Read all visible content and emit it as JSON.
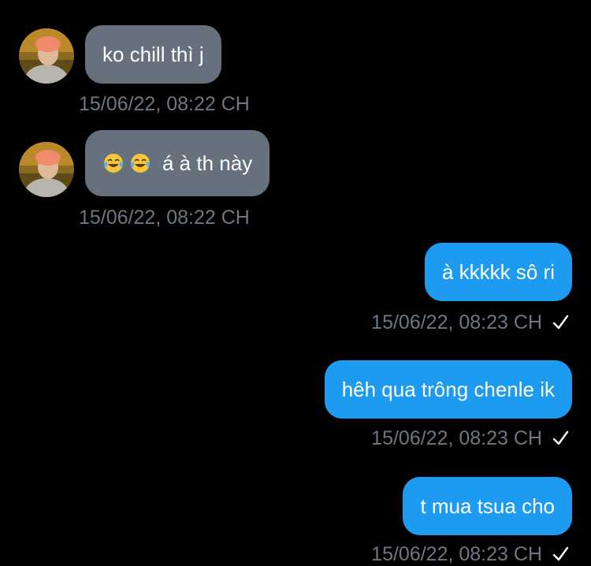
{
  "messages": [
    {
      "direction": "incoming",
      "text": "ko chill thì j",
      "timestamp": "15/06/22, 08:22 CH"
    },
    {
      "direction": "incoming",
      "emoji": [
        "face-with-tears-of-joy-icon",
        "face-with-tears-of-joy-icon"
      ],
      "text": "á à th này",
      "timestamp": "15/06/22, 08:22 CH"
    },
    {
      "direction": "outgoing",
      "text": "à kkkkk sô ri",
      "timestamp": "15/06/22, 08:23 CH",
      "status": "sent-check-icon"
    },
    {
      "direction": "outgoing",
      "text": "hêh qua trông chenle ik",
      "timestamp": "15/06/22, 08:23 CH",
      "status": "sent-check-icon"
    },
    {
      "direction": "outgoing",
      "text": "t mua tsua cho",
      "timestamp": "15/06/22, 08:23 CH",
      "status": "sent-check-icon"
    }
  ],
  "colors": {
    "background": "#000000",
    "incoming_bubble": "#66717d",
    "outgoing_bubble": "#1d9bf0",
    "timestamp": "#6e7681",
    "bubble_text": "#ffffff",
    "check": "#ffffff"
  }
}
